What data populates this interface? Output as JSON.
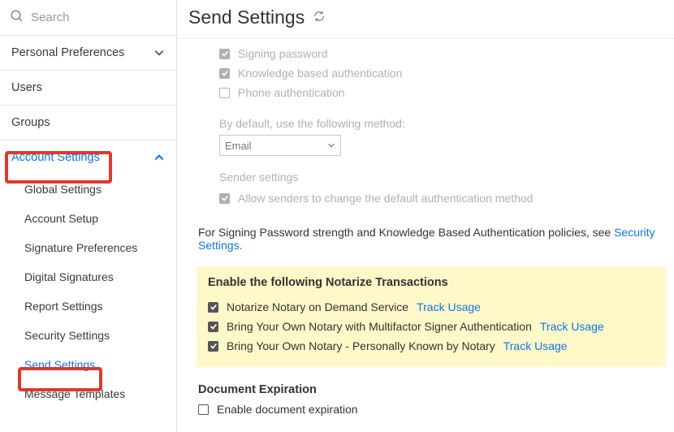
{
  "search": {
    "placeholder": "Search"
  },
  "sidebar": {
    "personal_prefs": "Personal Preferences",
    "users": "Users",
    "groups": "Groups",
    "account_settings": "Account Settings",
    "sub": {
      "global_settings": "Global Settings",
      "account_setup": "Account Setup",
      "signature_prefs": "Signature Preferences",
      "digital_sigs": "Digital Signatures",
      "report_settings": "Report Settings",
      "security_settings": "Security Settings",
      "send_settings": "Send Settings",
      "message_templates": "Message Templates"
    }
  },
  "main": {
    "title": "Send Settings",
    "auth": {
      "signing_password": "Signing password",
      "kba": "Knowledge based authentication",
      "phone_auth": "Phone authentication"
    },
    "default_method_label": "By default, use the following method:",
    "method_selected": "Email",
    "sender_settings_label": "Sender settings",
    "sender_allow": "Allow senders to change the default authentication method",
    "blurb_text": "For Signing Password strength and Knowledge Based Authentication policies, see ",
    "blurb_link": "Security Settings.",
    "notarize": {
      "title": "Enable the following Notarize Transactions",
      "r1": "Notarize Notary on Demand Service",
      "r2": "Bring Your Own Notary with Multifactor Signer Authentication",
      "r3": "Bring Your Own Notary - Personally Known by Notary",
      "track": "Track Usage"
    },
    "doc_exp_title": "Document Expiration",
    "doc_exp_option": "Enable document expiration"
  }
}
